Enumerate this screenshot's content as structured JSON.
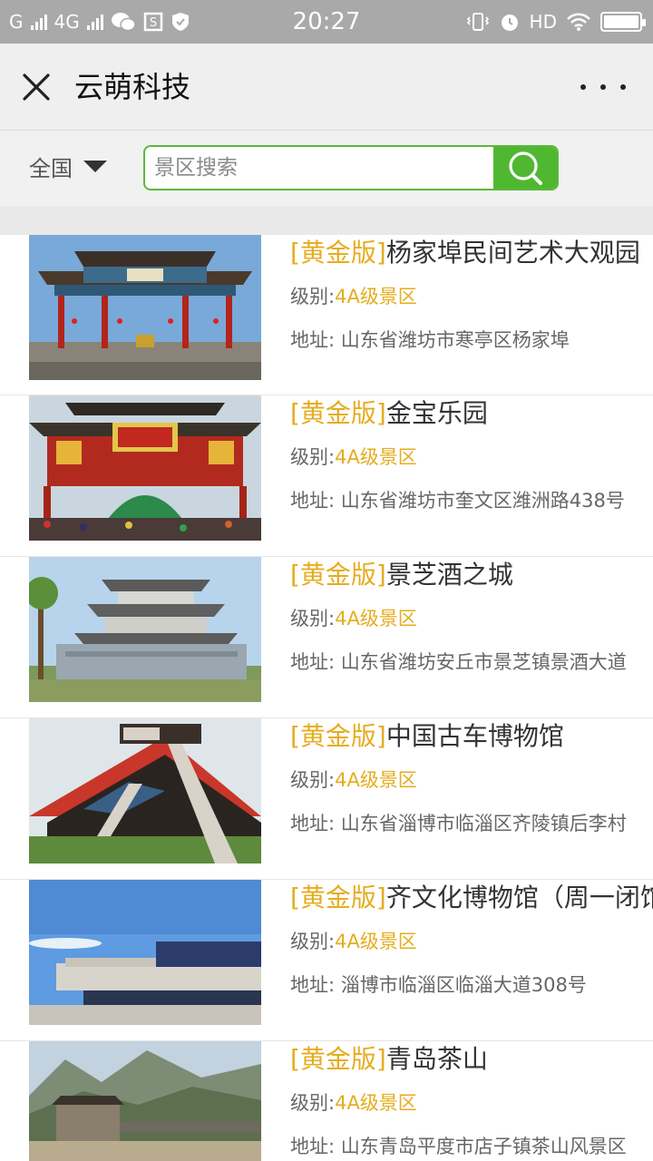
{
  "status": {
    "carrier1": "G",
    "carrier2": "4G",
    "time": "20:27",
    "hd": "HD"
  },
  "header": {
    "title": "云萌科技"
  },
  "search": {
    "region": "全国",
    "placeholder": "景区搜索"
  },
  "colors": {
    "accent_green": "#4fb830",
    "gold_tag": "#e6ac1e"
  },
  "list": {
    "level_label": "级别:",
    "address_label": "地址: ",
    "items": [
      {
        "tag": "[黄金版]",
        "name": "杨家埠民间艺术大观园",
        "level": "4A级景区",
        "address": "山东省潍坊市寒亭区杨家埠"
      },
      {
        "tag": "[黄金版]",
        "name": "金宝乐园",
        "level": "4A级景区",
        "address": "山东省潍坊市奎文区潍洲路438号"
      },
      {
        "tag": "[黄金版]",
        "name": "景芝酒之城",
        "level": "4A级景区",
        "address": "山东省潍坊安丘市景芝镇景酒大道"
      },
      {
        "tag": "[黄金版]",
        "name": "中国古车博物馆",
        "level": "4A级景区",
        "address": "山东省淄博市临淄区齐陵镇后李村"
      },
      {
        "tag": "[黄金版]",
        "name": "齐文化博物馆（周一闭馆）",
        "level": "4A级景区",
        "address": "淄博市临淄区临淄大道308号"
      },
      {
        "tag": "[黄金版]",
        "name": "青岛茶山",
        "level": "4A级景区",
        "address": "山东青岛平度市店子镇茶山风景区"
      }
    ]
  }
}
